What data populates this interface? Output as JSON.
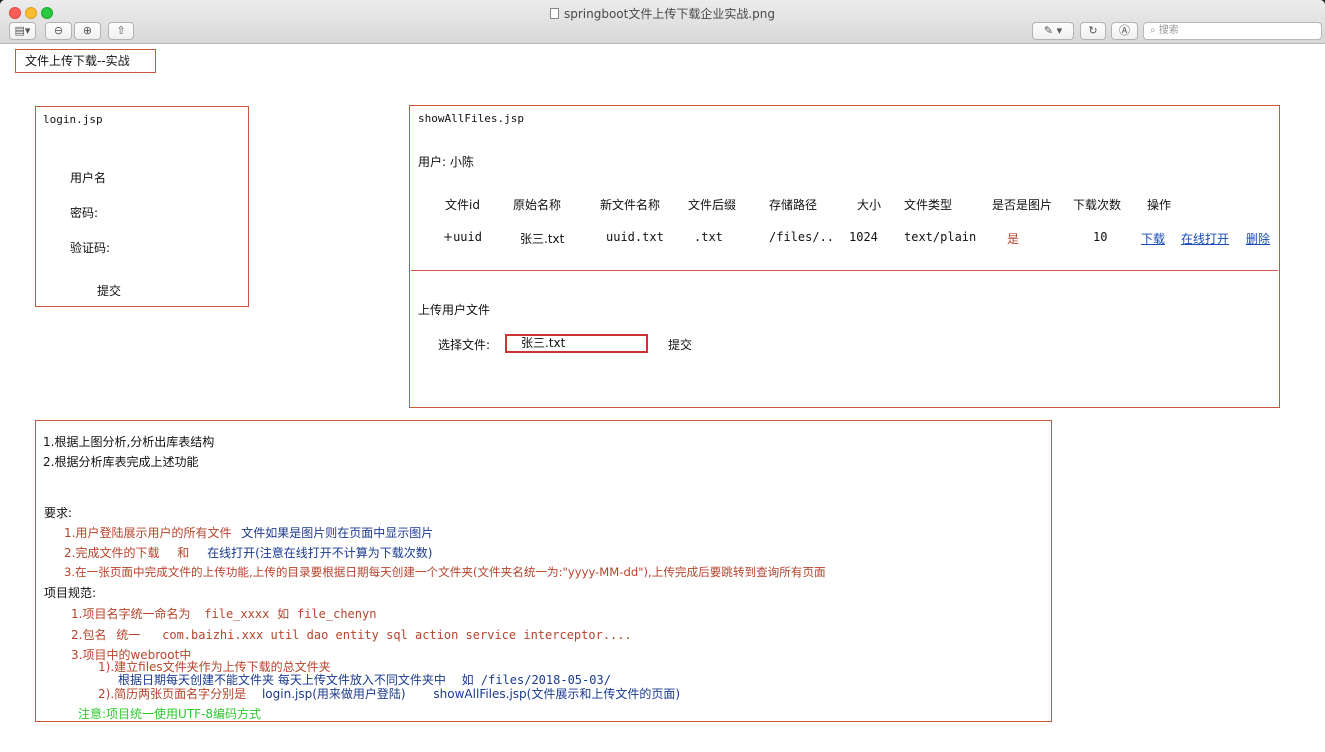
{
  "window": {
    "title": "springboot文件上传下载企业实战.png",
    "search_placeholder": "搜索"
  },
  "header": {
    "title": "文件上传下载--实战"
  },
  "login": {
    "file": "login.jsp",
    "username_label": "用户名",
    "password_label": "密码:",
    "captcha_label": "验证码:",
    "submit_label": "提交"
  },
  "files": {
    "file": "showAllFiles.jsp",
    "user_label": "用户: 小陈",
    "columns": [
      "文件id",
      "原始名称",
      "新文件名称",
      "文件后缀",
      "存储路径",
      "大小",
      "文件类型",
      "是否是图片",
      "下载次数",
      "操作"
    ],
    "row": {
      "id": "uuid",
      "original_name": "张三.txt",
      "new_name": "uuid.txt",
      "suffix": ".txt",
      "path": "/files/..",
      "size": "1024",
      "type": "text/plain",
      "is_image": "是",
      "downloads": "10"
    },
    "actions": {
      "download": "下载",
      "open_online": "在线打开",
      "delete": "删除"
    },
    "upload_title": "上传用户文件",
    "choose_label": "选择文件:",
    "chosen_file": "张三.txt",
    "upload_submit": "提交"
  },
  "requirements": {
    "analysis": [
      "1.根据上图分析,分析出库表结构",
      "2.根据分析库表完成上述功能"
    ],
    "req_title": "要求:",
    "req1_a": "1.用户登陆展示用户的所有文件",
    "req1_b": "文件如果是图片则在页面中显示图片",
    "req2_a": "2.完成文件的下载",
    "req2_b": "和",
    "req2_c": "在线打开(注意在线打开不计算为下载次数)",
    "req3": "3.在一张页面中完成文件的上传功能,上传的目录要根据日期每天创建一个文件夹(文件夹名统一为:\"yyyy-MM-dd\"),上传完成后要跳转到查询所有页面",
    "spec_title": "项目规范:",
    "spec1_a": "1.项目名字统一命名为",
    "spec1_b": "file_xxxx",
    "spec1_c": "如",
    "spec1_d": "file_chenyn",
    "spec2_a": "2.包名",
    "spec2_b": "统一",
    "spec2_c": "com.baizhi.xxx  util dao entity sql action service interceptor....",
    "spec3": "3.项目中的webroot中",
    "spec3_1": "1).建立files文件夹作为上传下载的总文件夹",
    "spec3_1b_a": "根据日期每天创建不能文件夹 每天上传文件放入不同文件夹中",
    "spec3_1b_b": "如 /files/2018-05-03/",
    "spec3_2_a": "2).简历两张页面名字分别是",
    "spec3_2_b": "login.jsp(用来做用户登陆)",
    "spec3_2_c": "showAllFiles.jsp(文件展示和上传文件的页面)",
    "note": "注意:项目统一使用UTF-8编码方式"
  }
}
